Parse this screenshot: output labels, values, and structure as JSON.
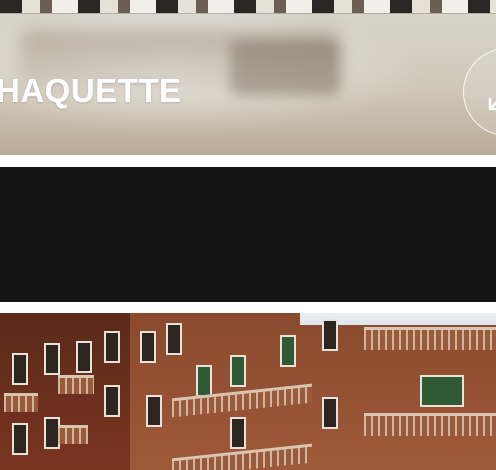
{
  "cards": {
    "top": {
      "title": "HAQUETTE"
    }
  },
  "colors": {
    "dark_band": "#141414",
    "title_text": "#ffffff",
    "brick": "#8c4a2c"
  },
  "icons": {
    "circle_button": "arrow-down-left-icon"
  }
}
